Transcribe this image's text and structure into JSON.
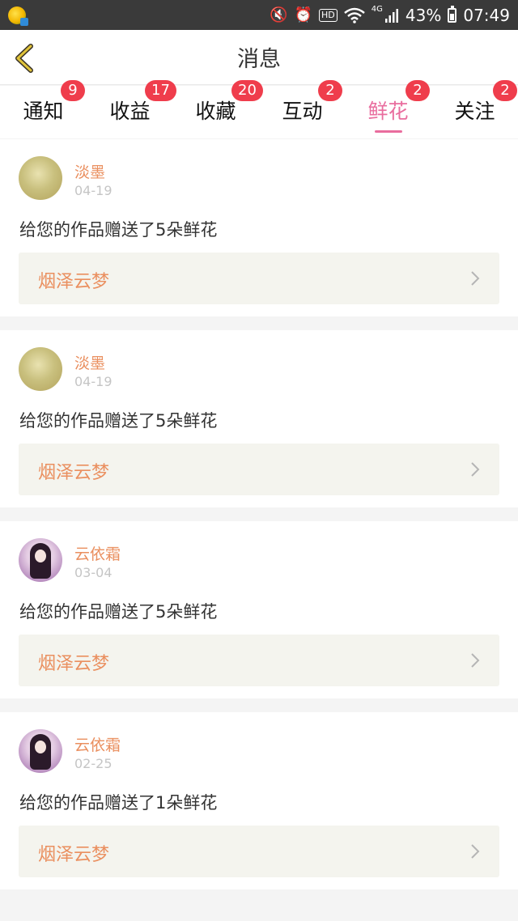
{
  "statusbar": {
    "battery": "43%",
    "time": "07:49",
    "hd": "HD",
    "network": "4G",
    "icons": [
      "app-notification-icon",
      "mute-icon",
      "alarm-icon",
      "hd-icon",
      "wifi-icon",
      "signal-icon",
      "battery-icon"
    ]
  },
  "header": {
    "title": "消息"
  },
  "tabs": [
    {
      "label": "通知",
      "badge": "9"
    },
    {
      "label": "收益",
      "badge": "17"
    },
    {
      "label": "收藏",
      "badge": "20"
    },
    {
      "label": "互动",
      "badge": "2"
    },
    {
      "label": "鲜花",
      "badge": "2",
      "active": true
    },
    {
      "label": "关注",
      "badge": "2"
    }
  ],
  "feed": [
    {
      "user": "淡墨",
      "date": "04-19",
      "message": "给您的作品赠送了5朵鲜花",
      "work": "烟泽云梦",
      "avatar": "gold"
    },
    {
      "user": "淡墨",
      "date": "04-19",
      "message": "给您的作品赠送了5朵鲜花",
      "work": "烟泽云梦",
      "avatar": "gold"
    },
    {
      "user": "云依霜",
      "date": "03-04",
      "message": "给您的作品赠送了5朵鲜花",
      "work": "烟泽云梦",
      "avatar": "anime"
    },
    {
      "user": "云依霜",
      "date": "02-25",
      "message": "给您的作品赠送了1朵鲜花",
      "work": "烟泽云梦",
      "avatar": "anime"
    }
  ],
  "colors": {
    "accent_pink": "#e96d9e",
    "username_orange": "#ea8f5f",
    "badge_red": "#ef3d4c",
    "back_arrow": "#e0c33a"
  }
}
